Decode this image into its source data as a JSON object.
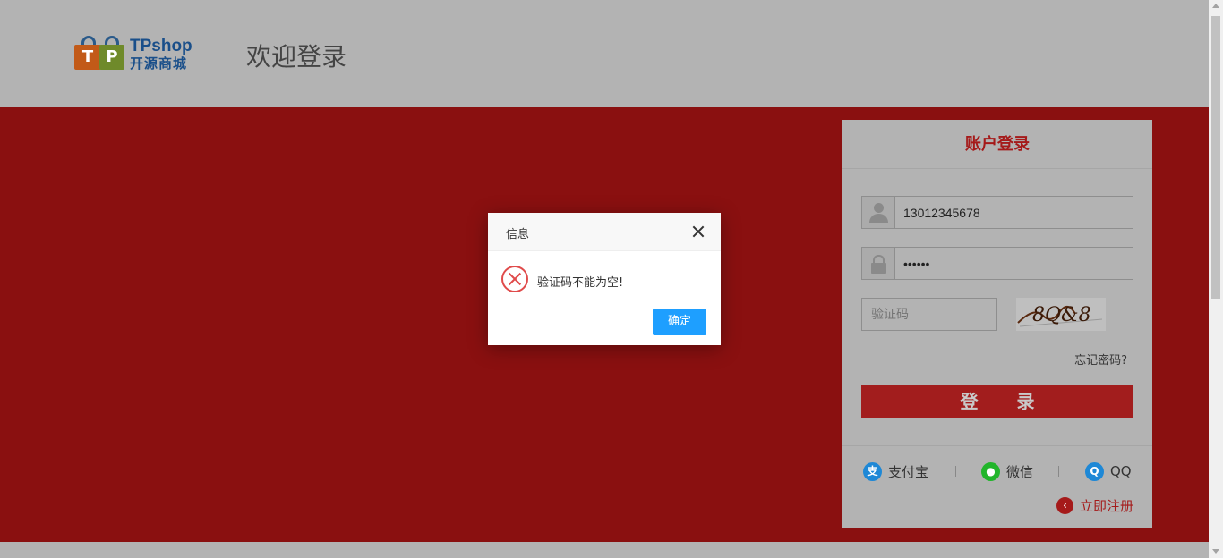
{
  "header": {
    "logo_en": "TPshop",
    "logo_cn": "开源商城",
    "logo_letter_1": "T",
    "logo_letter_2": "P",
    "welcome": "欢迎登录"
  },
  "login": {
    "title": "账户登录",
    "username_value": "13012345678",
    "password_value": "••••••",
    "captcha_placeholder": "验证码",
    "captcha_text": "8Q&8",
    "forgot": "忘记密码?",
    "submit": "登 录",
    "social": [
      {
        "label": "支付宝",
        "icon": "alipay-icon",
        "glyph": "支",
        "color": "#1e88d6"
      },
      {
        "label": "微信",
        "icon": "wechat-icon",
        "glyph": "●",
        "color": "#22b52b"
      },
      {
        "label": "QQ",
        "icon": "qq-icon",
        "glyph": "Q",
        "color": "#1e88d6"
      }
    ],
    "register": "立即注册",
    "register_glyph": "‹"
  },
  "dialog": {
    "title": "信息",
    "message": "验证码不能为空!",
    "ok": "确定"
  },
  "colors": {
    "banner": "#8a1010",
    "accent": "#a51a1a",
    "dialog_button": "#1e9fff",
    "error": "#e04b4b"
  }
}
